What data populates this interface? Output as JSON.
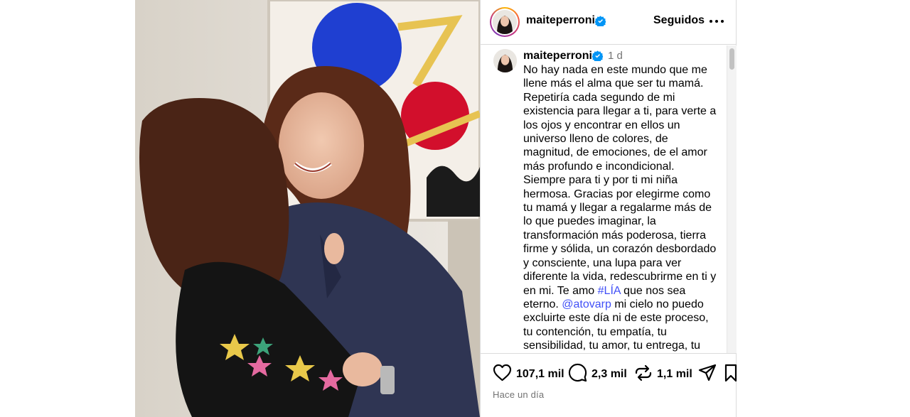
{
  "post": {
    "username": "maiteperroni",
    "follow_label": "Seguidos",
    "caption_time": "1 d",
    "caption_lines": [
      [
        {
          "t": "No hay nada en este mundo que me"
        }
      ],
      [
        {
          "t": "llene más el alma que ser tu mamá."
        }
      ],
      [
        {
          "t": "Repetiría cada segundo de mi"
        }
      ],
      [
        {
          "t": "existencia para llegar a ti, para verte a"
        }
      ],
      [
        {
          "t": "los ojos y encontrar en ellos un"
        }
      ],
      [
        {
          "t": "universo lleno de colores, de"
        }
      ],
      [
        {
          "t": "magnitud, de emociones, de el amor"
        }
      ],
      [
        {
          "t": "más profundo e incondicional."
        }
      ],
      [
        {
          "t": "Siempre para ti y por ti mi niña"
        }
      ],
      [
        {
          "t": "hermosa. Gracias por elegirme como"
        }
      ],
      [
        {
          "t": "tu mamá y llegar a regalarme más de"
        }
      ],
      [
        {
          "t": "lo que puedes imaginar, la"
        }
      ],
      [
        {
          "t": "transformación más poderosa, tierra"
        }
      ],
      [
        {
          "t": "firme y sólida, un corazón desbordado"
        }
      ],
      [
        {
          "t": "y consciente, una lupa para ver"
        }
      ],
      [
        {
          "t": "diferente la vida, redescubrirme en ti y"
        }
      ],
      [
        {
          "t": "en mi. Te amo "
        },
        {
          "t": "#LÍA",
          "link": true
        },
        {
          "t": " que nos sea"
        }
      ],
      [
        {
          "t": "eterno.  "
        },
        {
          "t": "@atovarp",
          "link": true
        },
        {
          "t": " mi cielo no puedo"
        }
      ],
      [
        {
          "t": "excluirte este día ni de este proceso,"
        }
      ],
      [
        {
          "t": "tu contención, tu empatía, tu"
        }
      ],
      [
        {
          "t": "sensibilidad, tu amor,  tu entrega, tu"
        }
      ]
    ],
    "likes": "107,1 mil",
    "comments": "2,3 mil",
    "reposts": "1,1 mil",
    "posted_ago": "Hace un día"
  },
  "colors": {
    "verified": "#0095f6",
    "link": "#4150f7",
    "muted": "#737373",
    "border": "#dbdbdb"
  },
  "icons": {
    "verified": "verified-badge-icon",
    "more": "more-options-icon",
    "like": "heart-icon",
    "comment": "comment-icon",
    "repost": "repost-icon",
    "share": "share-icon",
    "save": "bookmark-icon"
  }
}
